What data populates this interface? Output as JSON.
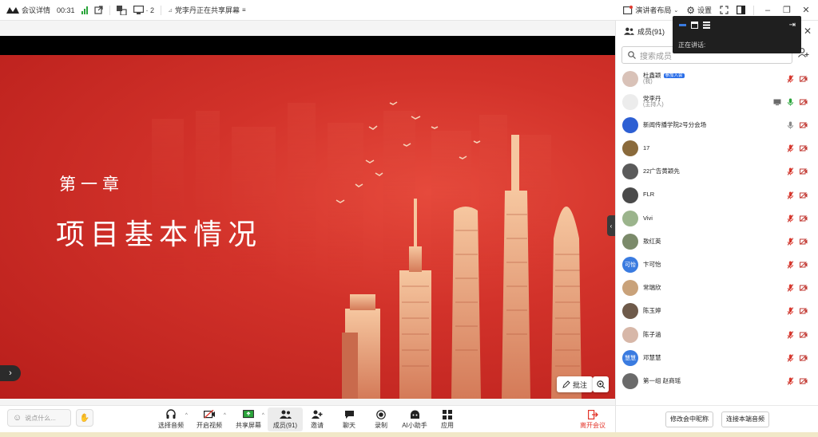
{
  "topbar": {
    "meeting_details": "会议详情",
    "duration": "00:31",
    "participant_count": "· 2",
    "sharing_status": "党李丹正在共享屏幕",
    "presenter_layout": "演讲者布局",
    "settings": "设置"
  },
  "slide": {
    "chapter": "第一章",
    "title": "项目基本情况"
  },
  "stage": {
    "annotate_label": "批注"
  },
  "toolbar": {
    "say_placeholder": "说点什么...",
    "audio": "选择音频",
    "video": "开启视频",
    "share": "共享屏幕",
    "members": "成员(91)",
    "invite": "邀请",
    "chat": "聊天",
    "record": "录制",
    "ai": "AI小助手",
    "apps": "应用",
    "leave": "离开会议"
  },
  "panel": {
    "title": "成员(91)",
    "search_placeholder": "搜索成员",
    "members": [
      {
        "name": "杜鑫颖",
        "sub": "(我)",
        "badge": "参加入会",
        "avatar": "#d9c2b8",
        "avatar_text": "",
        "video": true,
        "mic": "muted",
        "mic_color": "#e03a2f"
      },
      {
        "name": "党李丹",
        "sub": "(主持人)",
        "badge": "",
        "avatar": "#ececec",
        "avatar_text": "",
        "video": true,
        "mic": "on",
        "mic_color": "#2ba53b",
        "share": true
      },
      {
        "name": "新闻传播学院2号分会场",
        "sub": "",
        "badge": "",
        "avatar": "#2d5fd3",
        "avatar_text": "",
        "video": true,
        "mic": "on",
        "mic_color": "#888"
      },
      {
        "name": "17",
        "sub": "",
        "badge": "",
        "avatar": "#8a6a3b",
        "avatar_text": "",
        "video": true,
        "mic": "muted",
        "mic_color": "#e03a2f"
      },
      {
        "name": "22广告黄颖先",
        "sub": "",
        "badge": "",
        "avatar": "#5a5a5a",
        "avatar_text": "",
        "video": true,
        "mic": "muted",
        "mic_color": "#e03a2f"
      },
      {
        "name": "FLR",
        "sub": "",
        "badge": "",
        "avatar": "#4a4a4a",
        "avatar_text": "",
        "video": true,
        "mic": "muted",
        "mic_color": "#e03a2f"
      },
      {
        "name": "Vivi",
        "sub": "",
        "badge": "",
        "avatar": "#9bb48c",
        "avatar_text": "",
        "video": true,
        "mic": "muted",
        "mic_color": "#e03a2f"
      },
      {
        "name": "敖红英",
        "sub": "",
        "badge": "",
        "avatar": "#7b8a6a",
        "avatar_text": "",
        "video": true,
        "mic": "muted",
        "mic_color": "#e03a2f"
      },
      {
        "name": "卞可怡",
        "sub": "",
        "badge": "",
        "avatar": "#3a7be0",
        "avatar_text": "可怡",
        "video": true,
        "mic": "muted",
        "mic_color": "#e03a2f"
      },
      {
        "name": "常瑞欣",
        "sub": "",
        "badge": "",
        "avatar": "#c9a27a",
        "avatar_text": "",
        "video": true,
        "mic": "muted",
        "mic_color": "#e03a2f"
      },
      {
        "name": "陈玉婷",
        "sub": "",
        "badge": "",
        "avatar": "#6e5a4a",
        "avatar_text": "",
        "video": true,
        "mic": "muted",
        "mic_color": "#e03a2f"
      },
      {
        "name": "陈子涵",
        "sub": "",
        "badge": "",
        "avatar": "#d7b7a8",
        "avatar_text": "",
        "video": true,
        "mic": "muted",
        "mic_color": "#e03a2f"
      },
      {
        "name": "邓慧慧",
        "sub": "",
        "badge": "",
        "avatar": "#3a7be0",
        "avatar_text": "慧慧",
        "video": true,
        "mic": "muted",
        "mic_color": "#e03a2f"
      },
      {
        "name": "第一组 赵商瑶",
        "sub": "",
        "badge": "",
        "avatar": "#6a6a6a",
        "avatar_text": "",
        "video": true,
        "mic": "muted",
        "mic_color": "#e03a2f"
      }
    ],
    "btn_rename": "修改会中昵称",
    "btn_audio": "连接本端音频"
  },
  "presenter_popup": {
    "speaking_label": "正在讲话:"
  }
}
